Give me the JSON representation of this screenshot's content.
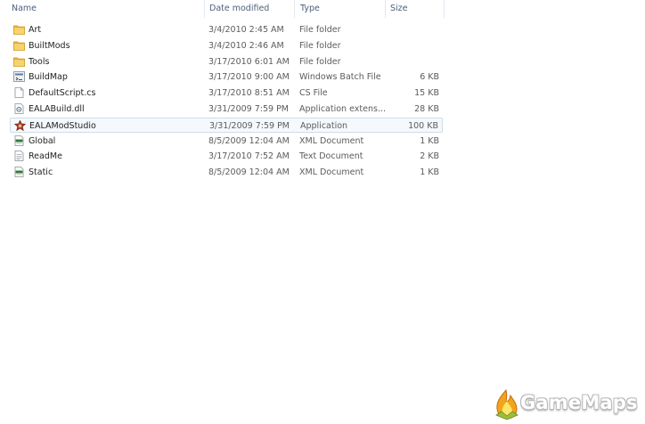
{
  "columns": {
    "name": "Name",
    "date": "Date modified",
    "type": "Type",
    "size": "Size"
  },
  "files": [
    {
      "icon": "folder-icon",
      "name": "Art",
      "date": "3/4/2010 2:45 AM",
      "type": "File folder",
      "size": ""
    },
    {
      "icon": "folder-icon",
      "name": "BuiltMods",
      "date": "3/4/2010 2:46 AM",
      "type": "File folder",
      "size": ""
    },
    {
      "icon": "folder-icon",
      "name": "Tools",
      "date": "3/17/2010 6:01 AM",
      "type": "File folder",
      "size": ""
    },
    {
      "icon": "batch-file-icon",
      "name": "BuildMap",
      "date": "3/17/2010 9:00 AM",
      "type": "Windows Batch File",
      "size": "6 KB"
    },
    {
      "icon": "document-icon",
      "name": "DefaultScript.cs",
      "date": "3/17/2010 8:51 AM",
      "type": "CS File",
      "size": "15 KB"
    },
    {
      "icon": "dll-icon",
      "name": "EALABuild.dll",
      "date": "3/31/2009 7:59 PM",
      "type": "Application extens...",
      "size": "28 KB"
    },
    {
      "icon": "app-icon",
      "name": "EALAModStudio",
      "date": "3/31/2009 7:59 PM",
      "type": "Application",
      "size": "100 KB",
      "selected": true
    },
    {
      "icon": "xml-icon",
      "name": "Global",
      "date": "8/5/2009 12:04 AM",
      "type": "XML Document",
      "size": "1 KB"
    },
    {
      "icon": "text-icon",
      "name": "ReadMe",
      "date": "3/17/2010 7:52 AM",
      "type": "Text Document",
      "size": "2 KB"
    },
    {
      "icon": "xml-icon",
      "name": "Static",
      "date": "8/5/2009 12:04 AM",
      "type": "XML Document",
      "size": "1 KB"
    }
  ],
  "watermark": {
    "text": "GameMaps"
  },
  "colors": {
    "folder": "#e8b632",
    "selection_border": "#cfdde8",
    "header_text": "#4c607a"
  }
}
